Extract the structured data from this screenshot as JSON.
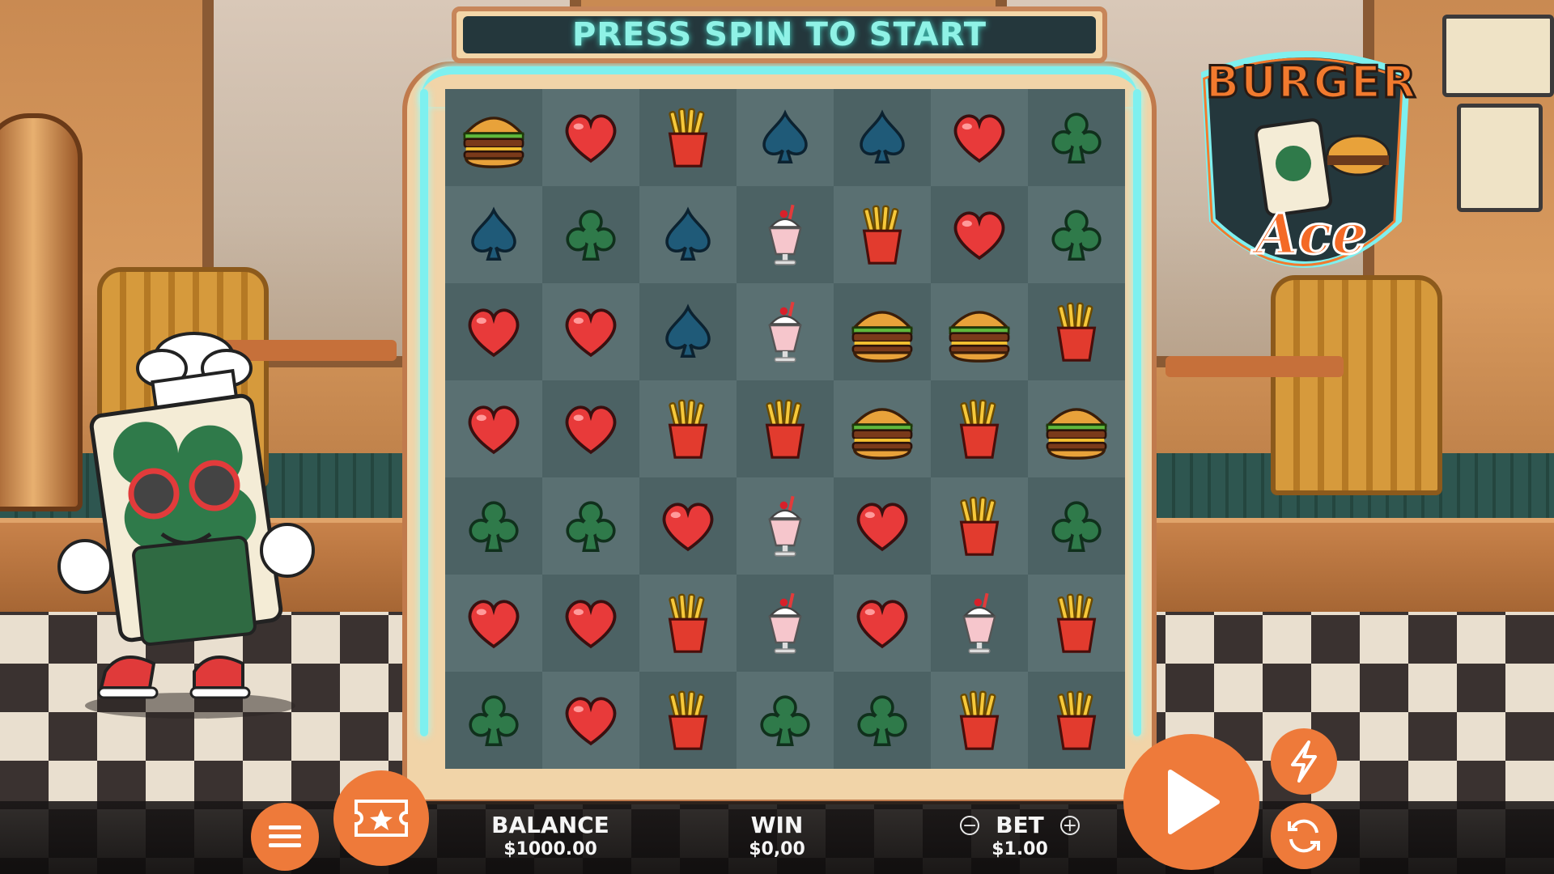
{
  "header": {
    "message": "PRESS SPIN TO START"
  },
  "logo": {
    "line1": "BURGER",
    "line2": "Ace"
  },
  "grid": {
    "rows": [
      [
        "burger",
        "heart",
        "fries",
        "spade",
        "spade",
        "heart",
        "club"
      ],
      [
        "spade",
        "club",
        "spade",
        "milkshake",
        "fries",
        "heart",
        "club"
      ],
      [
        "heart",
        "heart",
        "spade",
        "milkshake",
        "burger",
        "burger",
        "fries"
      ],
      [
        "heart",
        "heart",
        "fries",
        "fries",
        "burger",
        "fries",
        "burger"
      ],
      [
        "club",
        "club",
        "heart",
        "milkshake",
        "heart",
        "fries",
        "club"
      ],
      [
        "heart",
        "heart",
        "fries",
        "milkshake",
        "heart",
        "milkshake",
        "fries"
      ],
      [
        "club",
        "heart",
        "fries",
        "club",
        "club",
        "fries",
        "fries"
      ]
    ]
  },
  "bottom_bar": {
    "balance_label": "BALANCE",
    "balance_value": "$1000.00",
    "win_label": "WIN",
    "win_value": "$0,00",
    "bet_label": "BET",
    "bet_value": "$1.00",
    "bet_minus": "−",
    "bet_plus": "+"
  },
  "icons": {
    "menu": "hamburger-menu-icon",
    "ticket": "ticket-star-icon",
    "spin": "play-icon",
    "turbo": "lightning-icon",
    "autoplay": "refresh-icon"
  },
  "colors": {
    "accent": "#ee7a3a",
    "neon": "#7ef0ef",
    "title_text": "#8ff2e6",
    "heart": "#e83a3a",
    "spade": "#1f5a78",
    "club": "#2f7a4a",
    "cell_dark": "#4c6264",
    "cell_light": "#5a7072"
  }
}
